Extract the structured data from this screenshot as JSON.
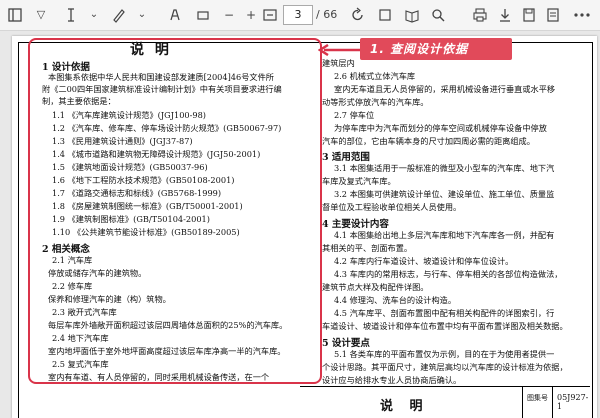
{
  "toolbar": {
    "page_current": "3",
    "page_total": "/ 66"
  },
  "callout": {
    "text": "1. 查阅设计依据"
  },
  "doc": {
    "heading": "说  明",
    "left": {
      "section1_title": "1  设计依据",
      "intro_lines": [
        "本图集系依据中华人民共和国建设部发建质[2004]46号文件所",
        "附《二00四年国家建筑标准设计编制计划》中有关项目要求进行编",
        "制，其主要依据是："
      ],
      "refs": [
        "1.1 《汽车库建筑设计规范》(JGJ100-98)",
        "1.2 《汽车库、修车库、停车场设计防火规范》(GB50067-97)",
        "1.3 《民用建筑设计通则》(JGJ37-87)",
        "1.4 《城市道路和建筑物无障碍设计规范》(JGJ50-2001)",
        "1.5 《建筑地面设计规范》(GB50037-96)",
        "1.6 《地下工程防水技术规范》(GB50108-2001)",
        "1.7 《道路交通标志和标线》(GB5768-1999)",
        "1.8 《房屋建筑制图统一标准》(GB/T50001-2001)",
        "1.9 《建筑制图标准》(GB/T50104-2001)",
        "1.10 《公共建筑节能设计标准》(GB50189-2005)"
      ],
      "section2_title": "2  相关概念",
      "concepts": [
        "2.1 汽车库",
        "停放或储存汽车的建筑物。",
        "2.2 修车库",
        "保养和修理汽车的建（构）筑物。",
        "2.3 敞开式汽车库",
        "每层车库外墙敞开面积超过该层四周墙体总面积的25%的汽车库。",
        "2.4 地下汽车库",
        "室内地坪面低于室外地坪面高度超过该层车库净高一半的汽车库。",
        "2.5 复式汽车库",
        "室内有车道、有人员停留的，同时采用机械设备传送，在一个"
      ]
    },
    "right": {
      "lines_top": [
        "建筑层内",
        "2.6 机械式立体汽车库",
        "室内无车道且无人员停留的，采用机械设备进行垂直或水平移",
        "动等形式停放汽车的汽车库。",
        "2.7 停车位",
        "为停车库中为汽车而划分的停车空间或机械停车设备中停放",
        "汽车的部位，它由车辆本身的尺寸加四周必需的距离组成。"
      ],
      "section3_title": "3  适用范围",
      "scope": [
        "3.1 本图集适用于一般标准的微型及小型车的汽车库、地下汽",
        "车库及复式汽车库。",
        "3.2 本图集可供建筑设计单位、建设单位、施工单位、质量监",
        "督单位及工程验收单位相关人员使用。"
      ],
      "section4_title": "4  主要设计内容",
      "content": [
        "4.1 本图集给出地上多层汽车库和地下汽车库各一例，并配有",
        "其相关的平、剖面布置。",
        "4.2 车库内行车道设计、坡道设计和停车位设计。",
        "4.3 车库内的常用标志，与行车、停车相关的各部位构造做法，",
        "建筑节点大样及构配件详图。",
        "4.4 修理沟、洗车台的设计构造。",
        "4.5 汽车库平、剖面布置图中配有相关构配件的详图索引，行",
        "车道设计、坡道设计和停车位布置中均有平面布置详图及相关数据。"
      ],
      "section5_title": "5  设计要点",
      "points": [
        "5.1 各类车库的平面布置仅为示例，目的在于为使用者提供一",
        "个设计思路。其平面尺寸，建筑层高均以汽车库的设计标准为依据，",
        "设计应与给排水专业人员协商后确认。"
      ]
    },
    "titleblock": {
      "title": "说  明",
      "label": "图集号",
      "code": "05J927-1"
    }
  }
}
